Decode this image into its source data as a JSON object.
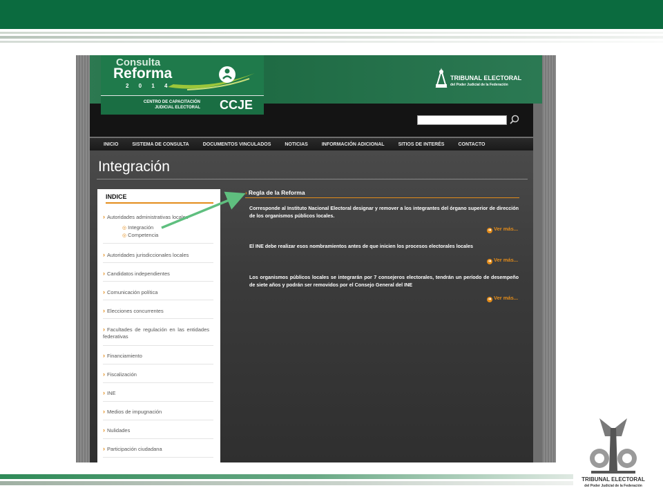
{
  "slide": {
    "corner_logo": {
      "name": "TRIBUNAL ELECTORAL",
      "sub": "del Poder Judicial de la Federación"
    }
  },
  "site": {
    "logo": {
      "line1": "Consulta",
      "line2": "Reforma",
      "year": "2 0 1 4",
      "center_small": "CENTRO DE CAPACITACIÓN\nJUDICIAL ELECTORAL",
      "center_big": "CCJE"
    },
    "tribunal": {
      "name": "TRIBUNAL ELECTORAL",
      "sub": "del Poder Judicial de la Federación"
    },
    "search": {
      "value": "",
      "placeholder": ""
    },
    "nav": [
      "INICIO",
      "SISTEMA DE CONSULTA",
      "DOCUMENTOS VINCULADOS",
      "NOTICIAS",
      "INFORMACIÓN ADICIONAL",
      "SITIOS DE INTERÉS",
      "CONTACTO"
    ],
    "page_title": "Integración",
    "sidebar": {
      "heading": "INDICE",
      "items": [
        "Autoridades administrativas locales",
        "Autoridades jurisdiccionales locales",
        "Candidatos independientes",
        "Comunicación política",
        "Elecciones concurrentes",
        "Facultades de regulación en las entidades federativas",
        "Financiamiento",
        "Fiscalización",
        "INE",
        "Medios de impugnación",
        "Nulidades",
        "Participación ciudadana"
      ],
      "subitems": [
        "Integración",
        "Competencia"
      ]
    },
    "article": {
      "heading": "Regla de la Reforma",
      "paragraphs": [
        "Corresponde al Instituto Nacional Electoral designar y remover a los integrantes del órgano superior de dirección de los organismos públicos locales.",
        "El INE debe realizar esos nombramientos antes de que inicien los procesos electorales locales",
        "Los organismos públicos locales se integrarán por 7 consejeros electorales, tendrán un período de desempeño de siete años y podrán ser removidos por el Consejo General del INE"
      ],
      "more_label": "Ver más..."
    }
  },
  "colors": {
    "brand_green": "#0b6b3f",
    "accent_orange": "#e38c1a",
    "annotation_arrow": "#5fbf7f"
  }
}
